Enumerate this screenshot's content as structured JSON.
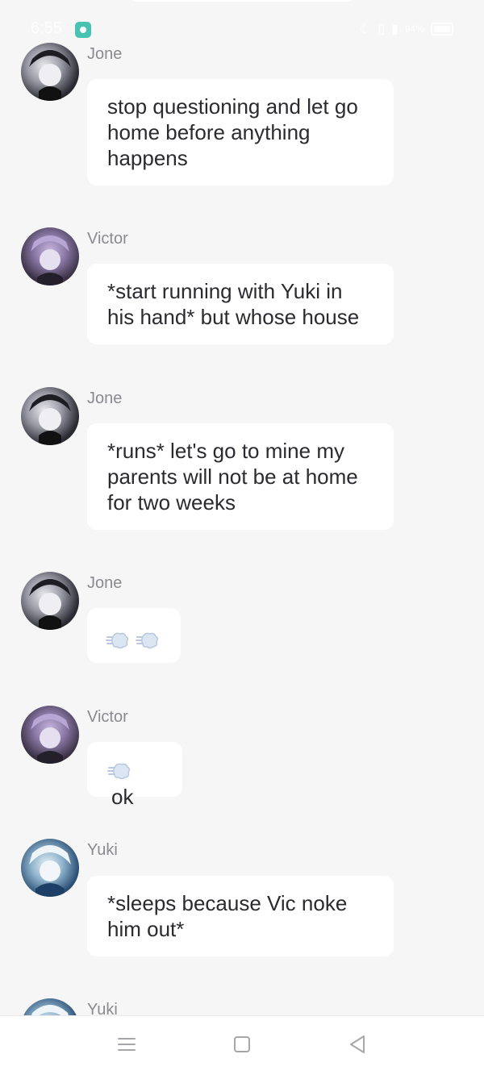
{
  "status_bar": {
    "time": "6:55",
    "battery_percent": "94%"
  },
  "messages": [
    {
      "sender": "Jone",
      "text": "stop questioning and let go home before anything happens"
    },
    {
      "sender": "Victor",
      "text": "*start running with Yuki in his hand* but whose house"
    },
    {
      "sender": "Jone",
      "text": "*runs* let's go to mine my parents will not be at home for two weeks"
    },
    {
      "sender": "Jone",
      "emojis": [
        "dash-emoji-icon",
        "dash-emoji-icon"
      ]
    },
    {
      "sender": "Victor",
      "emojis": [
        "dash-emoji-icon"
      ],
      "text": "ok"
    },
    {
      "sender": "Yuki",
      "text": "*sleeps because Vic noke him out*"
    },
    {
      "sender": "Yuki"
    }
  ],
  "colors": {
    "background": "#f6f6f7",
    "bubble": "#ffffff",
    "sender_text": "#8a8a8f",
    "message_text": "#2b2b2f"
  }
}
